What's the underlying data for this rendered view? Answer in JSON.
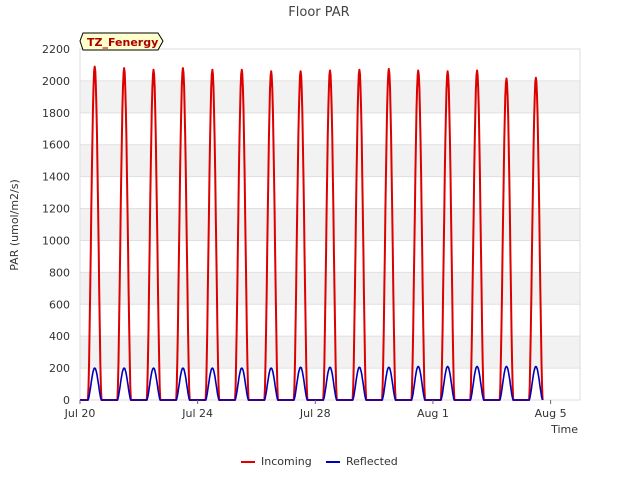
{
  "chart_data": {
    "type": "line",
    "title": "Floor PAR",
    "xlabel": "Time",
    "ylabel": "PAR (umol/m2/s)",
    "badge": "TZ_Fenergy",
    "ylim": [
      0,
      2200
    ],
    "yticks": [
      0,
      200,
      400,
      600,
      800,
      1000,
      1200,
      1400,
      1600,
      1800,
      2000,
      2200
    ],
    "xlim": [
      "2023-07-20",
      "2023-08-06"
    ],
    "xticks": [
      {
        "date": "2023-07-20",
        "label": "Jul 20"
      },
      {
        "date": "2023-07-24",
        "label": "Jul 24"
      },
      {
        "date": "2023-07-28",
        "label": "Jul 28"
      },
      {
        "date": "2023-08-01",
        "label": "Aug 1"
      },
      {
        "date": "2023-08-05",
        "label": "Aug 5"
      }
    ],
    "grid": true,
    "legend_position": "bottom",
    "days": [
      "2023-07-20",
      "2023-07-21",
      "2023-07-22",
      "2023-07-23",
      "2023-07-24",
      "2023-07-25",
      "2023-07-26",
      "2023-07-27",
      "2023-07-28",
      "2023-07-29",
      "2023-07-30",
      "2023-07-31",
      "2023-08-01",
      "2023-08-02",
      "2023-08-03",
      "2023-08-04",
      "2023-08-05"
    ],
    "series": [
      {
        "name": "Incoming",
        "color": "#dd0000",
        "daily_peak": [
          2090,
          2080,
          2070,
          2080,
          2070,
          2070,
          2060,
          2060,
          2065,
          2070,
          2075,
          2065,
          2060,
          2065,
          2015,
          2020,
          0
        ]
      },
      {
        "name": "Reflected",
        "color": "#0000bb",
        "daily_peak": [
          200,
          200,
          200,
          200,
          200,
          200,
          200,
          205,
          205,
          205,
          205,
          210,
          210,
          210,
          210,
          210,
          0
        ]
      }
    ]
  }
}
